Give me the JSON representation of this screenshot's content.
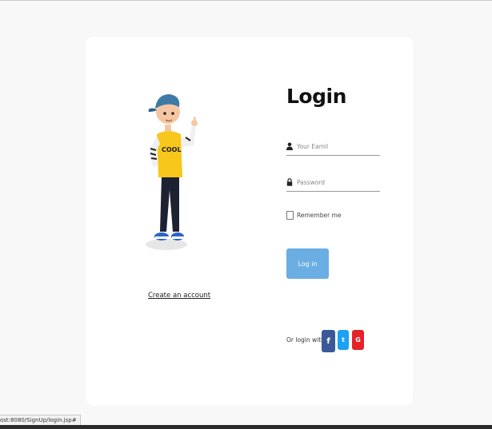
{
  "page": {
    "title": "Login",
    "create_account_link": "Create an account"
  },
  "form": {
    "email_placeholder": "Your Eamil",
    "password_placeholder": "Password",
    "remember_label": "Remember me",
    "remember_checked": false,
    "login_button": "Log in"
  },
  "social": {
    "label": "Or login with",
    "buttons": [
      {
        "name": "facebook",
        "glyph": "f",
        "color": "#3b5998"
      },
      {
        "name": "twitter",
        "glyph": "t",
        "color": "#1da1f2"
      },
      {
        "name": "google",
        "glyph": "G",
        "color": "#e52228"
      }
    ]
  },
  "status_bar": {
    "url": "ost:8080/SignUp/login.jsp#"
  },
  "colors": {
    "accent": "#6aaee3",
    "background": "#f8f8f8",
    "card": "#ffffff"
  },
  "icons": [
    "person-icon",
    "lock-icon",
    "facebook-icon",
    "twitter-icon",
    "google-icon",
    "character-illustration"
  ]
}
